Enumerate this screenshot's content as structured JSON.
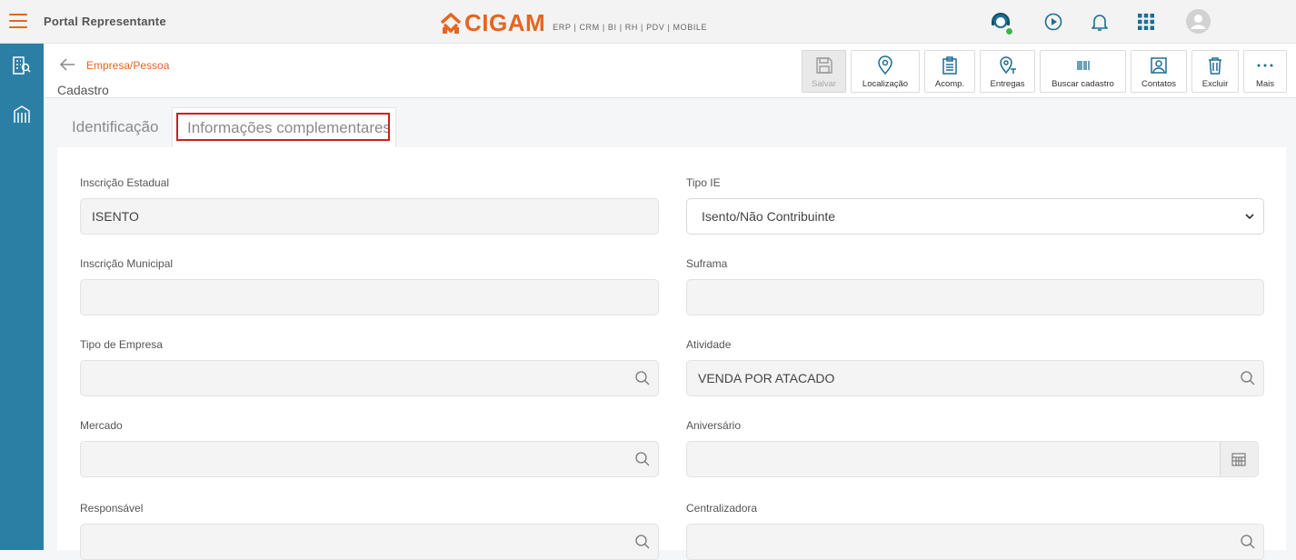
{
  "header": {
    "title": "Portal Representante",
    "logo_text": "CIGAM",
    "logo_subtitle": "ERP | CRM | BI | RH | PDV | MOBILE",
    "icons": [
      "menu-icon",
      "support-agent-icon",
      "play-icon",
      "bell-icon",
      "apps-grid-icon",
      "user-avatar-icon"
    ],
    "status_color": "#3cb44b"
  },
  "sidebar": {
    "items": [
      {
        "icon": "building-search-icon"
      },
      {
        "icon": "store-icon"
      }
    ]
  },
  "page": {
    "breadcrumb": "Empresa/Pessoa",
    "title": "Cadastro"
  },
  "toolbar": {
    "buttons": [
      {
        "label": "Salvar",
        "icon": "save-icon",
        "enabled": false
      },
      {
        "label": "Localização",
        "icon": "location-pin-icon",
        "enabled": true
      },
      {
        "label": "Acomp.",
        "icon": "clipboard-icon",
        "enabled": true
      },
      {
        "label": "Entregas",
        "icon": "delivery-pin-icon",
        "enabled": true
      },
      {
        "label": "Buscar cadastro",
        "icon": "barcode-icon",
        "enabled": true
      },
      {
        "label": "Contatos",
        "icon": "contact-card-icon",
        "enabled": true
      },
      {
        "label": "Excluir",
        "icon": "trash-icon",
        "enabled": true
      },
      {
        "label": "Mais",
        "icon": "more-dots-icon",
        "enabled": true
      }
    ]
  },
  "tabs": [
    {
      "label": "Identificação",
      "active": false
    },
    {
      "label": "Informações complementares",
      "active": true
    }
  ],
  "form": {
    "inscricao_estadual": {
      "label": "Inscrição Estadual",
      "value": "ISENTO"
    },
    "tipo_ie": {
      "label": "Tipo IE",
      "value": "Isento/Não Contribuinte"
    },
    "inscricao_municipal": {
      "label": "Inscrição Municipal",
      "value": ""
    },
    "suframa": {
      "label": "Suframa",
      "value": ""
    },
    "tipo_empresa": {
      "label": "Tipo de Empresa",
      "value": ""
    },
    "atividade": {
      "label": "Atividade",
      "value": "VENDA POR ATACADO"
    },
    "mercado": {
      "label": "Mercado",
      "value": ""
    },
    "aniversario": {
      "label": "Aniversário",
      "value": ""
    },
    "responsavel": {
      "label": "Responsável",
      "value": ""
    },
    "centralizadora": {
      "label": "Centralizadora",
      "value": ""
    }
  },
  "colors": {
    "accent": "#e8641f",
    "sidebar": "#2b7fa5",
    "highlight": "#d01e1e"
  }
}
